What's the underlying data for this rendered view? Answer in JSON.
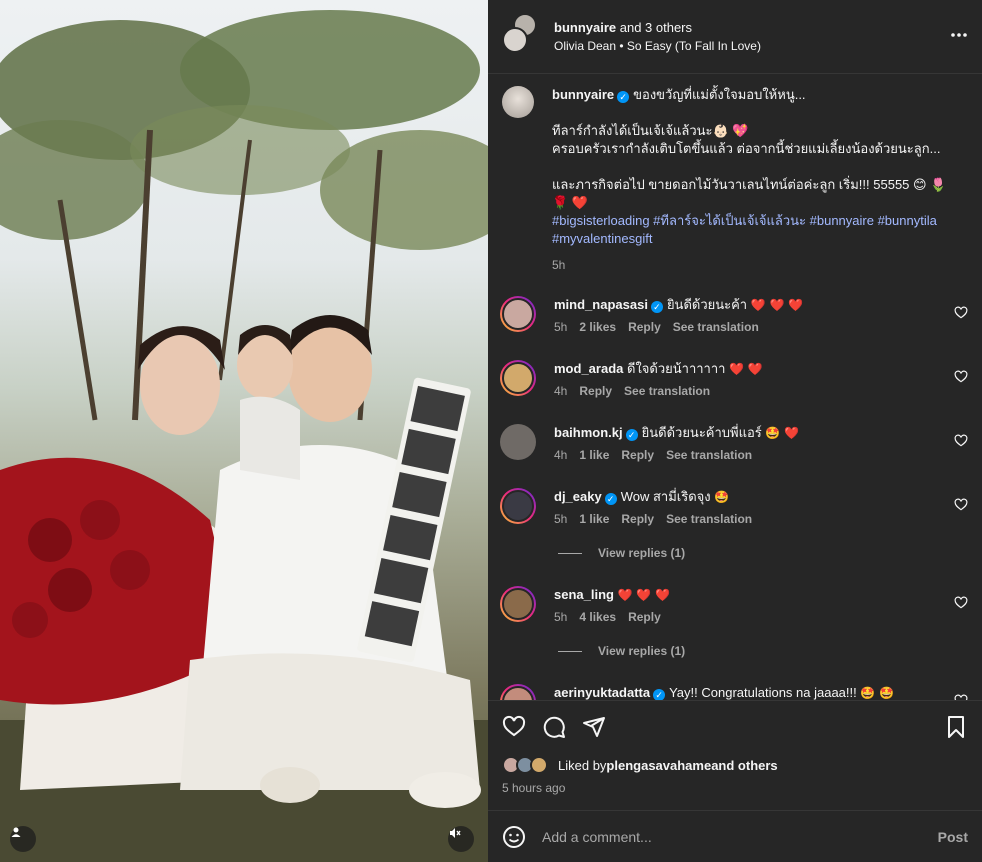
{
  "header": {
    "username": "bunnyaire",
    "and_others": " and 3 others",
    "music": "Olivia Dean • So Easy (To Fall In Love)",
    "more_icon": "more-horizontal-icon"
  },
  "caption": {
    "username": "bunnyaire",
    "line1": "ของขวัญที่แม่ตั้งใจมอบให้หนู...",
    "line2": "ทีลาร์กำลังได้เป็นเจ้เจ้แล้วนะ👶🏻 💖",
    "line3": "ครอบครัวเรากำลังเติบโตขึ้นแล้ว ต่อจากนี้ช่วยแม่เลี้ยงน้องด้วยนะลูก...",
    "line4": "และภารกิจต่อไป ขายดอกไม้วันวาเลนไทน์ต่อค่ะลูก เริ่ม!!! 55555 😊 🌷",
    "line5": "🌹 ❤️",
    "hashtags": "#bigsisterloading #ทีลาร์จะได้เป็นเจ้เจ้แล้วนะ #bunnyaire #bunnytila #myvalentinesgift",
    "time": "5h"
  },
  "comments": [
    {
      "username": "mind_napasasi",
      "verified": true,
      "text": "ยินดีด้วยนะค้า",
      "hearts": "❤️ ❤️ ❤️",
      "time": "5h",
      "likes": "2 likes",
      "reply": "Reply",
      "translate": "See translation",
      "ring": true,
      "avatar_color": "#c9a8a0"
    },
    {
      "username": "mod_arada",
      "verified": false,
      "text": "ดีใจด้วยน้าาาาาา",
      "hearts": "❤️ ❤️",
      "time": "4h",
      "likes": "",
      "reply": "Reply",
      "translate": "See translation",
      "ring": true,
      "avatar_color": "#d2a96b"
    },
    {
      "username": "baihmon.kj",
      "verified": true,
      "text": "ยินดีด้วยนะค้าบพี่แอร์",
      "hearts": "🤩 ❤️",
      "time": "4h",
      "likes": "1 like",
      "reply": "Reply",
      "translate": "See translation",
      "ring": false,
      "avatar_color": "#6f6a66"
    },
    {
      "username": "dj_eaky",
      "verified": true,
      "text": "Wow สามี่เริดจุง",
      "hearts": "🤩",
      "time": "5h",
      "likes": "1 like",
      "reply": "Reply",
      "translate": "See translation",
      "ring": true,
      "avatar_color": "#3a3a44",
      "view_replies": "View replies (1)"
    },
    {
      "username": "sena_ling",
      "verified": false,
      "text": "",
      "hearts": "❤️ ❤️ ❤️",
      "time": "5h",
      "likes": "4 likes",
      "reply": "Reply",
      "translate": "",
      "ring": true,
      "avatar_color": "#8a6a4a",
      "view_replies": "View replies (1)"
    },
    {
      "username": "aerinyuktadatta",
      "verified": true,
      "text": "Yay!! Congratulations na jaaaa!!!",
      "hearts": "🤩 🤩",
      "time": "",
      "likes": "",
      "reply": "",
      "translate": "",
      "ring": true,
      "avatar_color": "#c38c7c"
    }
  ],
  "actions": {
    "like_icon": "heart-icon",
    "comment_icon": "comment-icon",
    "share_icon": "share-icon",
    "save_icon": "bookmark-icon"
  },
  "likes": {
    "prefix": "Liked by ",
    "user": "plengasavahame",
    "suffix": " and others"
  },
  "time_ago": "5 hours ago",
  "comment_bar": {
    "placeholder": "Add a comment...",
    "post": "Post"
  },
  "colors": {
    "panel_bg": "#262626",
    "text": "#f5f5f5",
    "muted": "#a8a8a8",
    "link": "#a3b9ff",
    "verified": "#0095f6"
  }
}
